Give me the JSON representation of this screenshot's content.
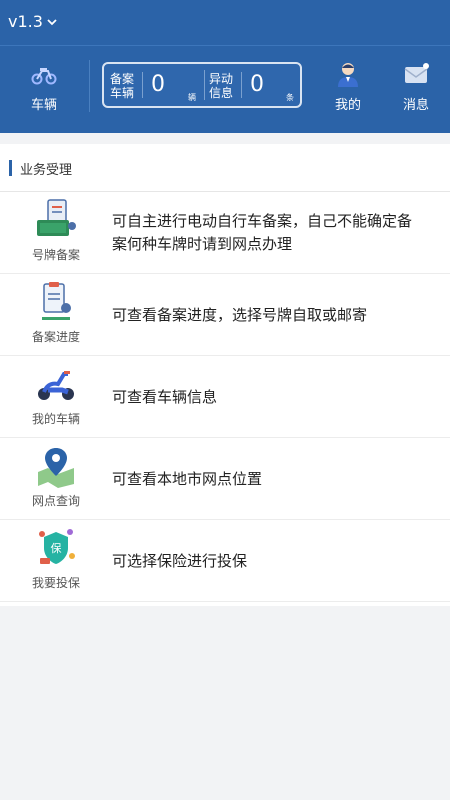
{
  "header": {
    "version": "v1.3",
    "nav": {
      "vehicle": "车辆",
      "mine": "我的",
      "messages": "消息"
    },
    "stats": {
      "filed_label_1": "备案",
      "filed_label_2": "车辆",
      "filed_count": "0",
      "filed_unit": "辆",
      "abnormal_label_1": "异动",
      "abnormal_label_2": "信息",
      "abnormal_count": "0",
      "abnormal_unit": "条"
    }
  },
  "section": {
    "title": "业务受理",
    "items": [
      {
        "label": "号牌备案",
        "desc": "可自主进行电动自行车备案，自己不能确定备案何种车牌时请到网点办理",
        "icon": "license-plate-register-icon"
      },
      {
        "label": "备案进度",
        "desc": "可查看备案进度，选择号牌自取或邮寄",
        "icon": "progress-clipboard-icon"
      },
      {
        "label": "我的车辆",
        "desc": "可查看车辆信息",
        "icon": "scooter-icon"
      },
      {
        "label": "网点查询",
        "desc": "可查看本地市网点位置",
        "icon": "map-pin-icon"
      },
      {
        "label": "我要投保",
        "desc": "可选择保险进行投保",
        "icon": "insurance-shield-icon"
      }
    ]
  },
  "colors": {
    "header_bg": "#2b63a8",
    "accent": "#2b63a8",
    "page_bg": "#f2f3f5"
  }
}
